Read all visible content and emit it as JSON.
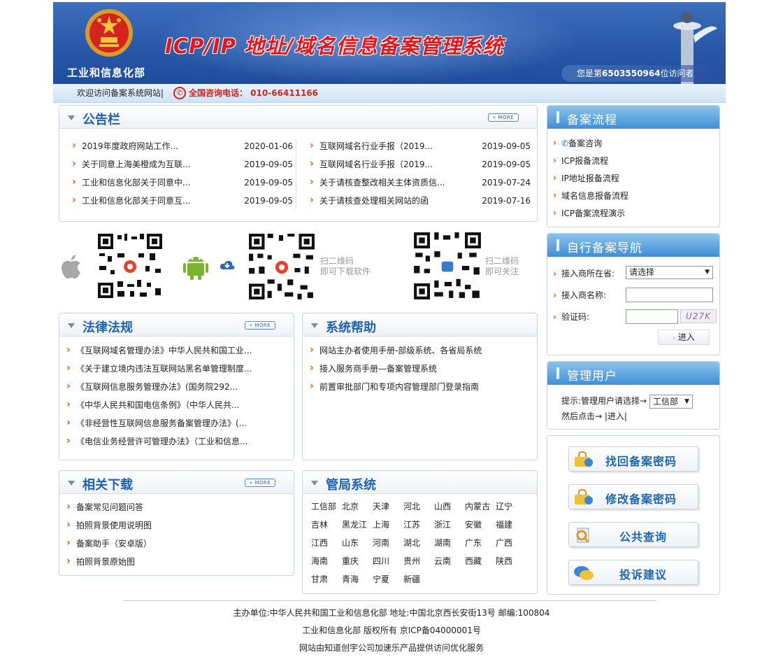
{
  "header": {
    "ministry": "工业和信息化部",
    "title": "ICP/IP 地址/域名信息备案管理系统",
    "visitor_prefix": "您是第",
    "visitor_count": "6503550964",
    "visitor_suffix": "位访问者"
  },
  "welcome": {
    "text": "欢迎访问备案系统网站|",
    "hotline": "全国咨询电话：  010-66411166"
  },
  "notice": {
    "title": "公告栏",
    "more": "» MORE",
    "left": [
      {
        "text": "2019年度政府网站工作...",
        "date": "2020-01-06"
      },
      {
        "text": "关于同意上海美橙成为互联...",
        "date": "2019-09-05"
      },
      {
        "text": "工业和信息化部关于同意中...",
        "date": "2019-09-05"
      },
      {
        "text": "工业和信息化部关于同意互...",
        "date": "2019-09-05"
      }
    ],
    "right": [
      {
        "text": "互联网域名行业手报（2019...",
        "date": "2019-09-05"
      },
      {
        "text": "互联网域名行业手报（2019...",
        "date": "2019-09-05"
      },
      {
        "text": "关于请核查整改相关主体资质信...",
        "date": "2019-07-24"
      },
      {
        "text": "关于请核查处理相关网站的函",
        "date": "2019-07-16"
      }
    ]
  },
  "qr": {
    "caption1_line1": "扫二维码",
    "caption1_line2": "即可下载软件",
    "caption2_line1": "扫二维码",
    "caption2_line2": "即可关注"
  },
  "laws": {
    "title": "法律法规",
    "more": "» MORE",
    "items": [
      "《互联网域名管理办法》中华人民共和国工业...",
      "《关于建立境内违法互联网站黑名单管理制度...",
      "《互联网信息服务管理办法》(国务院292...",
      "《中华人民共和国电信条例》（中华人民共...",
      "《非经营性互联网信息服务备案管理办法》(...",
      "《电信业务经营许可管理办法》（工业和信息..."
    ]
  },
  "help": {
    "title": "系统帮助",
    "items": [
      "网站主办者使用手册-部级系统、各省局系统",
      "接入服务商手册—备案管理系统",
      "前置审批部门和专项内容管理部门登录指南"
    ]
  },
  "downloads": {
    "title": "相关下载",
    "more": "» MORE",
    "items": [
      "备案常见问题问答",
      "拍照背景使用说明图",
      "备案助手（安卓版）",
      "拍照背景原始图"
    ]
  },
  "bureaus": {
    "title": "管局系统",
    "items": [
      "工信部",
      "北京",
      "天津",
      "河北",
      "山西",
      "内蒙古",
      "辽宁",
      "吉林",
      "黑龙江",
      "上海",
      "江苏",
      "浙江",
      "安徽",
      "福建",
      "江西",
      "山东",
      "河南",
      "湖北",
      "湖南",
      "广东",
      "广西",
      "海南",
      "重庆",
      "四川",
      "贵州",
      "云南",
      "西藏",
      "陕西",
      "甘肃",
      "青海",
      "宁夏",
      "新疆"
    ]
  },
  "process": {
    "title": "备案流程",
    "items": [
      "备案咨询",
      "ICP报备流程",
      "IP地址报备流程",
      "域名信息报备流程",
      "ICP备案流程演示"
    ]
  },
  "nav": {
    "title": "自行备案导航",
    "isp_label": "接入商所在省:",
    "isp_select": "请选择",
    "name_label": "接入商名称:",
    "captcha_label": "验证码:",
    "captcha_text": "U27K",
    "enter": "进入"
  },
  "admin": {
    "title": "管理用户",
    "hint": "提示:管理用户请选择→",
    "select": "工信部",
    "then": "然后点击→ |进入|"
  },
  "actions": {
    "recover": "找回备案密码",
    "change": "修改备案密码",
    "query": "公共查询",
    "complaint": "投诉建议"
  },
  "footer": {
    "line1": "主办单位:中华人民共和国工业和信息化部 地址:中国北京西长安街13号 邮编:100804",
    "line2": "工业和信息化部 版权所有 京ICP备04000001号",
    "line3": "网站由知道创宇公司加速乐产品提供访问优化服务"
  }
}
